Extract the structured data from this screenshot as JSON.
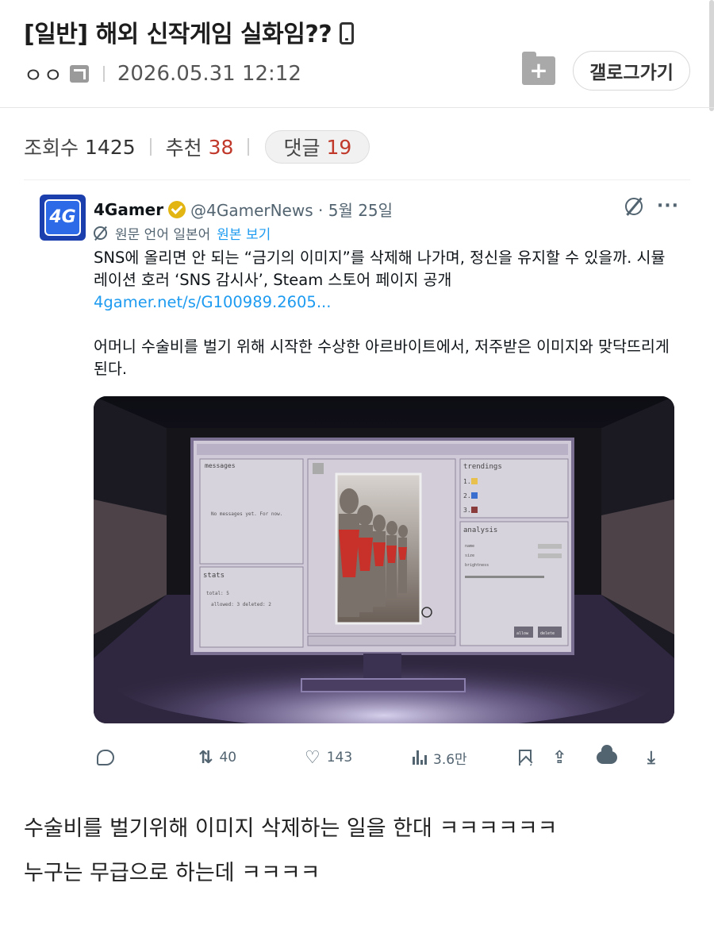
{
  "post": {
    "title": "[일반] 해외 신작게임 실화임??",
    "author": "ㅇㅇ",
    "datetime": "2026.05.31 12:12",
    "gallery_button": "갤로그가기",
    "add_icon": "folder-plus-icon"
  },
  "stats": {
    "views_label": "조회수",
    "views": "1425",
    "recommend_label": "추천",
    "recommend": "38",
    "comments_label": "댓글",
    "comments": "19"
  },
  "tweet": {
    "avatar_text": "4G",
    "name": "4Gamer",
    "handle_date": "@4GamerNews · 5월 25일",
    "translate_note": "원문 언어 일본어",
    "translate_link": "원본 보기",
    "body_line1": "SNS에 올리면 안 되는 “금기의 이미지”를 삭제해 나가며, 정신을 유지할 수 있을까. 시뮬레이션 호러 ‘SNS 감시사’, Steam 스토어 페이지 공개",
    "link": "4gamer.net/s/G100989.2605...",
    "body_line2": "어머니 수술비를 벌기 위해 시작한 수상한 아르바이트에서, 저주받은 이미지와 맞닥뜨리게 된다.",
    "actions": {
      "retweets": "40",
      "likes": "143",
      "views": "3.6만"
    }
  },
  "game_screen": {
    "messages_title": "messages",
    "messages_empty": "No messages yet. For now.",
    "stats_title": "stats",
    "stats_total": "total: 5",
    "stats_detail": "allowed: 3   deleted: 2",
    "trending_title": "trendings",
    "trending_items": [
      "1.",
      "2.",
      "3."
    ],
    "analysis_title": "analysis",
    "analysis_rows": [
      "name",
      "size",
      "brightness"
    ],
    "allow_btn": "allow",
    "delete_btn": "delete"
  },
  "body": {
    "line1": "수술비를 벌기위해 이미지 삭제하는 일을 한대 ㅋㅋㅋㅋㅋㅋ",
    "line2": "누구는 무급으로 하는데 ㅋㅋㅋㅋ"
  }
}
